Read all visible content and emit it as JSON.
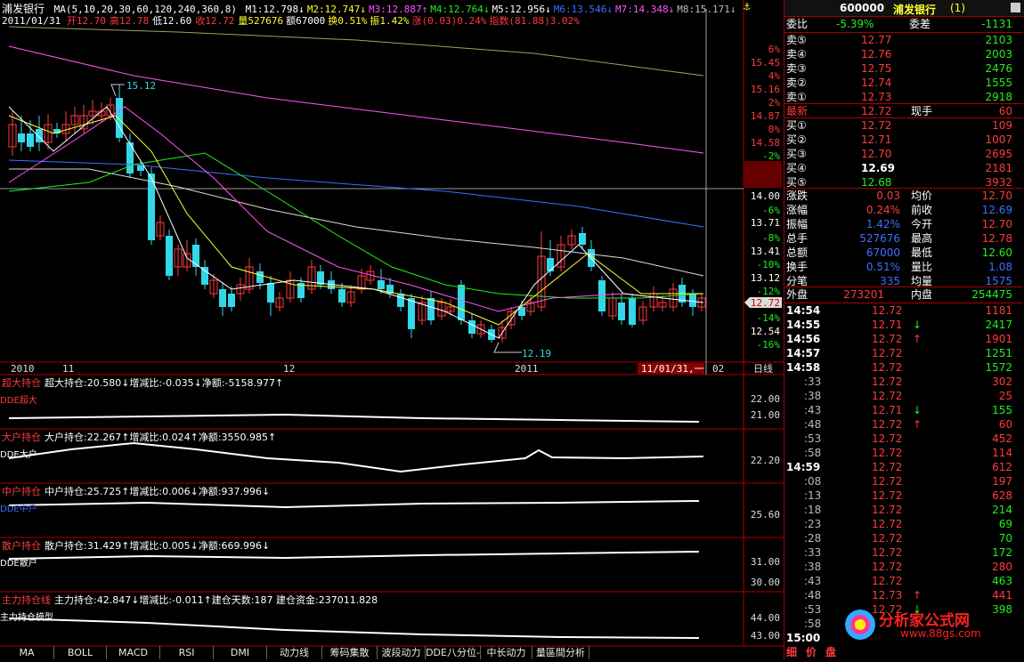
{
  "title": "浦发银行",
  "ma_label": "MA",
  "ma_params": "(5,10,20,30,60,120,240,360,8)",
  "ma_values": [
    {
      "label": "M1:12.798",
      "arrow": "↓",
      "color": "#ffffff"
    },
    {
      "label": "M2:12.747",
      "arrow": "↓",
      "color": "#ffff33"
    },
    {
      "label": "M3:12.887",
      "arrow": "↑",
      "color": "#ff55ff"
    },
    {
      "label": "M4:12.764",
      "arrow": "↓",
      "color": "#22ee22"
    },
    {
      "label": "M5:12.956",
      "arrow": "↓",
      "color": "#ffffff"
    },
    {
      "label": "M6:13.546",
      "arrow": "↓",
      "color": "#3f6fff"
    },
    {
      "label": "M7:14.348",
      "arrow": "↓",
      "color": "#ff55ff"
    },
    {
      "label": "M8:15.171",
      "arrow": "↓",
      "color": "#bbbbbb"
    }
  ],
  "quote_line": {
    "date": "2011/01/31",
    "open": "开12.70",
    "high": "高12.78",
    "low": "低12.60",
    "close": "收12.72",
    "volume": "量527676",
    "amount": "额67000",
    "turnover": "换0.51%",
    "amplitude": "振1.42%",
    "change": "涨(0.03)0.24%",
    "index": "指数(81.88)3.02%"
  },
  "price_axis": [
    {
      "label": "6%",
      "color": "#ff3b3b"
    },
    {
      "label": "15.45",
      "color": "#ff3b3b"
    },
    {
      "label": "4%",
      "color": "#ff3b3b"
    },
    {
      "label": "15.16",
      "color": "#ff3b3b"
    },
    {
      "label": "2%",
      "color": "#ff3b3b"
    },
    {
      "label": "14.87",
      "color": "#ff3b3b"
    },
    {
      "label": "0%",
      "color": "#ff3b3b"
    },
    {
      "label": "14.58",
      "color": "#ff3b3b"
    },
    {
      "label": "-2%",
      "color": "#22ee22"
    },
    {
      "label": "(2631)",
      "color": "#bbbbbb"
    },
    {
      "label": "13.96",
      "color": "#ffffff"
    },
    {
      "label": "14.00",
      "color": "#ffffff"
    },
    {
      "label": "-6%",
      "color": "#22ee22"
    },
    {
      "label": "13.71",
      "color": "#ffffff"
    },
    {
      "label": "-8%",
      "color": "#22ee22"
    },
    {
      "label": "13.41",
      "color": "#ffffff"
    },
    {
      "label": "-10%",
      "color": "#22ee22"
    },
    {
      "label": "13.12",
      "color": "#ffffff"
    },
    {
      "label": "-12%",
      "color": "#22ee22"
    },
    {
      "label": "12.83",
      "color": "#ffffff"
    },
    {
      "label": "-14%",
      "color": "#22ee22"
    },
    {
      "label": "12.54",
      "color": "#ffffff"
    },
    {
      "label": "-16%",
      "color": "#22ee22"
    }
  ],
  "current_price_tag": "12.72",
  "high_annotation": "15.12",
  "low_annotation": "12.19",
  "time_axis": [
    "2010",
    "11",
    "12",
    "2011",
    "11/01/31,一",
    "02",
    "日线"
  ],
  "subcharts": [
    {
      "tab": "超大持仓",
      "stat": "超大持仓:20.580↓增减比:-0.035↓净额:-5158.977↑",
      "legend": "DDE超大",
      "legend_color": "#ff3b3b",
      "ticks": [
        "22.00",
        "21.00"
      ]
    },
    {
      "tab": "大户持仓",
      "stat": "大户持仓:22.267↑增减比:0.024↑净额:3550.985↑",
      "legend": "DDE大户",
      "legend_color": "#ffffff",
      "ticks": [
        "22.20"
      ]
    },
    {
      "tab": "中户持仓",
      "stat": "中户持仓:25.725↑增减比:0.006↓净额:937.996↓",
      "legend": "DDE中户",
      "legend_color": "#3f6fff",
      "ticks": [
        "25.60"
      ]
    },
    {
      "tab": "散户持仓",
      "stat": "散户持仓:31.429↑增减比:0.005↓净额:669.996↓",
      "legend": "DDE散户",
      "legend_color": "#ffffff",
      "ticks": [
        "31.00",
        "30.00"
      ]
    },
    {
      "tab": "主力持仓线",
      "stat": "主力持仓:42.847↓增减比:-0.011↑建仓天数:187 建仓资金:237011.828",
      "legend": "主力持仓模型",
      "legend_color": "#ffffff",
      "ticks": [
        "44.00",
        "43.00"
      ]
    }
  ],
  "bottom_tabs": [
    "MA",
    "BOLL",
    "MACD",
    "RSI",
    "DMI",
    "动力线",
    "筹码集散",
    "波段动力",
    "DDE八分位-",
    "中长动力",
    "量區間分析"
  ],
  "panel": {
    "code": "600000",
    "name": "浦发银行",
    "name_suffix": "(1)",
    "weibi_label": "委比",
    "weibi_value": "-5.39%",
    "weicha_label": "委差",
    "weicha_value": "-1131",
    "asks": [
      {
        "label": "卖⑤",
        "price": "12.77",
        "vol": "2103"
      },
      {
        "label": "卖④",
        "price": "12.76",
        "vol": "2003"
      },
      {
        "label": "卖③",
        "price": "12.75",
        "vol": "2476"
      },
      {
        "label": "卖②",
        "price": "12.74",
        "vol": "1555"
      },
      {
        "label": "卖①",
        "price": "12.73",
        "vol": "2918"
      }
    ],
    "last_label": "最新",
    "last_price": "12.72",
    "xianshou_label": "现手",
    "xianshou_value": "60",
    "bids": [
      {
        "label": "买①",
        "price": "12.72",
        "vol": "109",
        "price_color": "#ff3b3b"
      },
      {
        "label": "买②",
        "price": "12.71",
        "vol": "1007",
        "price_color": "#ff3b3b"
      },
      {
        "label": "买③",
        "price": "12.70",
        "vol": "2695",
        "price_color": "#ff3b3b"
      },
      {
        "label": "买④",
        "price": "12.69",
        "vol": "2181",
        "price_color": "#ffffff"
      },
      {
        "label": "买⑤",
        "price": "12.68",
        "vol": "3932",
        "price_color": "#22ee22"
      }
    ],
    "stats": [
      {
        "l1": "涨跌",
        "v1": "0.03",
        "c1": "#ff3b3b",
        "l2": "均价",
        "v2": "12.70",
        "c2": "#ff3b3b"
      },
      {
        "l1": "涨幅",
        "v1": "0.24%",
        "c1": "#ff3b3b",
        "l2": "前收",
        "v2": "12.69",
        "c2": "#3f6fff"
      },
      {
        "l1": "振幅",
        "v1": "1.42%",
        "c1": "#3f6fff",
        "l2": "今开",
        "v2": "12.70",
        "c2": "#ff3b3b"
      },
      {
        "l1": "总手",
        "v1": "527676",
        "c1": "#3f6fff",
        "l2": "最高",
        "v2": "12.78",
        "c2": "#ff3b3b"
      },
      {
        "l1": "总额",
        "v1": "67000",
        "c1": "#3f6fff",
        "l2": "最低",
        "v2": "12.60",
        "c2": "#22ee22"
      },
      {
        "l1": "换手",
        "v1": "0.51%",
        "c1": "#3f6fff",
        "l2": "量比",
        "v2": "1.08",
        "c2": "#3f6fff"
      },
      {
        "l1": "分笔",
        "v1": "335",
        "c1": "#3f6fff",
        "l2": "均量",
        "v2": "1575",
        "c2": "#3f6fff"
      }
    ],
    "outer_label": "外盘",
    "outer_value": "273201",
    "inner_label": "内盘",
    "inner_value": "254475",
    "ticks": [
      {
        "t": "14:54",
        "p": "12.72",
        "a": "",
        "v": "1181",
        "pc": "#ff3b3b",
        "vc": "#ff3b3b",
        "big": true
      },
      {
        "t": "14:55",
        "p": "12.71",
        "a": "↓",
        "v": "2417",
        "pc": "#ff3b3b",
        "vc": "#22ee22",
        "big": true
      },
      {
        "t": "14:56",
        "p": "12.72",
        "a": "↑",
        "v": "1901",
        "pc": "#ff3b3b",
        "vc": "#ff3b3b",
        "big": true
      },
      {
        "t": "14:57",
        "p": "12.72",
        "a": "",
        "v": "1251",
        "pc": "#ff3b3b",
        "vc": "#22ee22",
        "big": true
      },
      {
        "t": "14:58",
        "p": "12.72",
        "a": "",
        "v": "1572",
        "pc": "#ff3b3b",
        "vc": "#22ee22",
        "big": true
      },
      {
        "t": ":33",
        "p": "12.72",
        "a": "",
        "v": "302",
        "pc": "#ff3b3b",
        "vc": "#ff3b3b",
        "big": false
      },
      {
        "t": ":38",
        "p": "12.72",
        "a": "",
        "v": "25",
        "pc": "#ff3b3b",
        "vc": "#ff3b3b",
        "big": false
      },
      {
        "t": ":43",
        "p": "12.71",
        "a": "↓",
        "v": "155",
        "pc": "#ff3b3b",
        "vc": "#22ee22",
        "big": false
      },
      {
        "t": ":48",
        "p": "12.72",
        "a": "↑",
        "v": "60",
        "pc": "#ff3b3b",
        "vc": "#ff3b3b",
        "big": false
      },
      {
        "t": ":53",
        "p": "12.72",
        "a": "",
        "v": "452",
        "pc": "#ff3b3b",
        "vc": "#ff3b3b",
        "big": false
      },
      {
        "t": ":58",
        "p": "12.72",
        "a": "",
        "v": "114",
        "pc": "#ff3b3b",
        "vc": "#ff3b3b",
        "big": false
      },
      {
        "t": "14:59",
        "p": "12.72",
        "a": "",
        "v": "612",
        "pc": "#ff3b3b",
        "vc": "#ff3b3b",
        "big": true
      },
      {
        "t": ":08",
        "p": "12.72",
        "a": "",
        "v": "197",
        "pc": "#ff3b3b",
        "vc": "#ff3b3b",
        "big": false
      },
      {
        "t": ":13",
        "p": "12.72",
        "a": "",
        "v": "628",
        "pc": "#ff3b3b",
        "vc": "#ff3b3b",
        "big": false
      },
      {
        "t": ":18",
        "p": "12.72",
        "a": "",
        "v": "214",
        "pc": "#ff3b3b",
        "vc": "#22ee22",
        "big": false
      },
      {
        "t": ":23",
        "p": "12.72",
        "a": "",
        "v": "69",
        "pc": "#ff3b3b",
        "vc": "#22ee22",
        "big": false
      },
      {
        "t": ":28",
        "p": "12.72",
        "a": "",
        "v": "70",
        "pc": "#ff3b3b",
        "vc": "#22ee22",
        "big": false
      },
      {
        "t": ":33",
        "p": "12.72",
        "a": "",
        "v": "172",
        "pc": "#ff3b3b",
        "vc": "#22ee22",
        "big": false
      },
      {
        "t": ":38",
        "p": "12.72",
        "a": "",
        "v": "280",
        "pc": "#ff3b3b",
        "vc": "#ff3b3b",
        "big": false
      },
      {
        "t": ":43",
        "p": "12.72",
        "a": "",
        "v": "463",
        "pc": "#ff3b3b",
        "vc": "#22ee22",
        "big": false
      },
      {
        "t": ":48",
        "p": "12.73",
        "a": "↑",
        "v": "441",
        "pc": "#ff3b3b",
        "vc": "#ff3b3b",
        "big": false
      },
      {
        "t": ":53",
        "p": "12.72",
        "a": "↓",
        "v": "398",
        "pc": "#ff3b3b",
        "vc": "#22ee22",
        "big": false
      },
      {
        "t": ":58",
        "p": "",
        "a": "",
        "v": "",
        "pc": "#ff3b3b",
        "vc": "#22ee22",
        "big": false
      },
      {
        "t": "15:00",
        "p": "",
        "a": "",
        "v": "",
        "pc": "#ff3b3b",
        "vc": "#22ee22",
        "big": true
      }
    ],
    "bottom_tabs": [
      "细",
      "价",
      "盘"
    ],
    "watermark_site": "分析家公式网",
    "watermark_url": "www.88gs.com"
  }
}
